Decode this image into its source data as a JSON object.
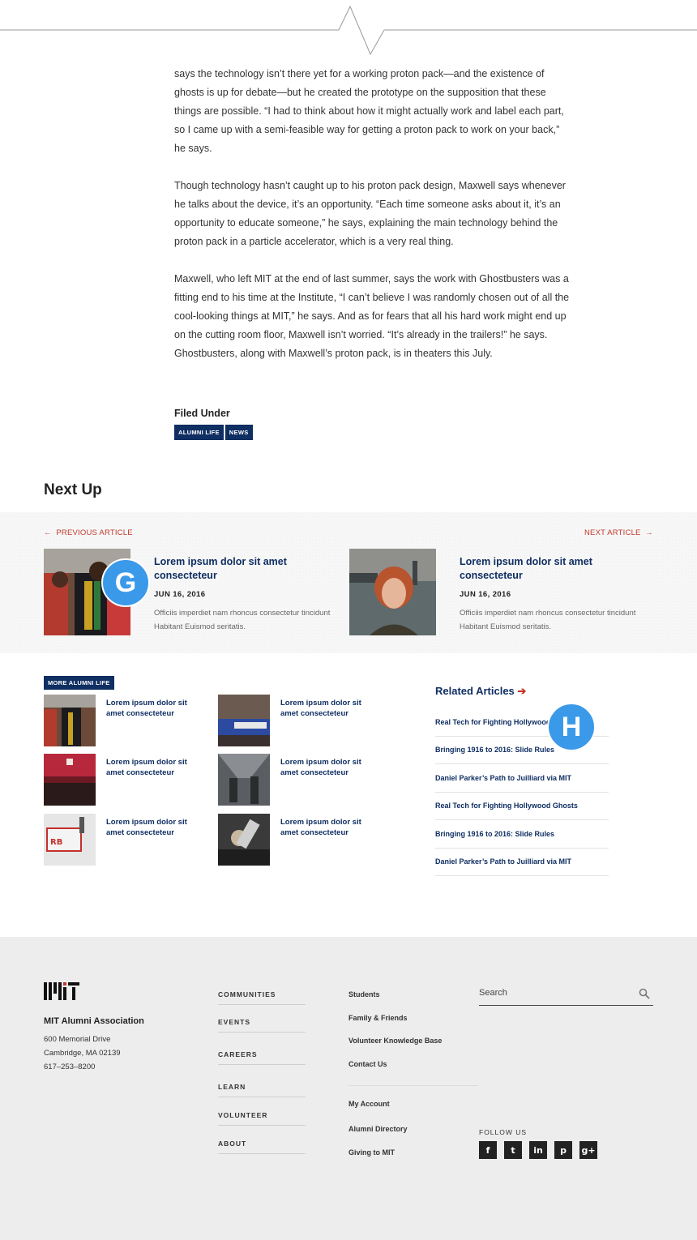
{
  "article": {
    "paragraphs": [
      "says the technology isn’t there yet for a working proton pack—and the existence of ghosts is up for debate—but he created the prototype on the supposition that these things are possible. “I had to think about how it might actually work and label each part, so I came up with a semi-feasible way for getting a proton pack to work on your back,” he says.",
      "Though technology hasn’t caught up to his proton pack design, Maxwell says whenever he talks about the device, it’s an opportunity. “Each time someone asks about it, it’s an opportunity to educate someone,” he says, explaining the main technology behind the proton pack in a particle accelerator, which is a very real thing.",
      "Maxwell, who left MIT at the end of last summer, says the work with Ghostbusters was a fitting end to his time at the Institute, “I can’t believe I was randomly chosen out of all the cool-looking things at MIT,” he says. And as for fears that all his hard work might end up on the cutting room floor, Maxwell isn’t worried. “It’s already in the trailers!” he says. Ghostbusters, along with Maxwell’s proton pack, is in theaters this July."
    ],
    "filed_under_label": "Filed Under",
    "tags": [
      "ALUMNI LIFE",
      "NEWS"
    ]
  },
  "next_up": {
    "title": "Next Up",
    "prev_label": "PREVIOUS ARTICLE",
    "next_label": "NEXT ARTICLE",
    "cards": [
      {
        "title": "Lorem ipsum dolor sit amet consecteteur",
        "date": "JUN 16, 2016",
        "desc": "Officiis imperdiet nam rhoncus consectetur tincidunt Habitant Euismod seritatis."
      },
      {
        "title": "Lorem ipsum dolor sit amet consecteteur",
        "date": "JUN 16, 2016",
        "desc": "Officiis imperdiet nam rhoncus consectetur tincidunt Habitant Euismod seritatis."
      }
    ]
  },
  "badges": {
    "g": "G",
    "h": "H"
  },
  "more": {
    "label": "MORE ALUMNI LIFE",
    "items": [
      "Lorem ipsum dolor sit amet consecteteur",
      "Lorem ipsum dolor sit amet consecteteur",
      "Lorem ipsum dolor sit amet consecteteur",
      "Lorem ipsum dolor sit amet consecteteur",
      "Lorem ipsum dolor sit amet consecteteur",
      "Lorem ipsum dolor sit amet consecteteur"
    ]
  },
  "related": {
    "title": "Related Articles",
    "arrow": "➔",
    "items": [
      "Real Tech for Fighting Hollywood Ghosts",
      "Bringing 1916 to 2016: Slide Rules",
      "Daniel Parker’s Path to Juilliard via MIT",
      "Real Tech for Fighting Hollywood Ghosts",
      "Bringing 1916 to 2016: Slide Rules",
      "Daniel Parker’s Path to Juilliard via MIT"
    ]
  },
  "footer": {
    "org_name": "MIT Alumni Association",
    "address": [
      "600 Memorial Drive",
      "Cambridge, MA 02139",
      "617–253–8200"
    ],
    "nav": [
      "COMMUNITIES",
      "EVENTS",
      "CAREERS",
      "LEARN",
      "VOLUNTEER",
      "ABOUT"
    ],
    "links_top": [
      "Students",
      "Family & Friends",
      "Volunteer Knowledge Base",
      "Contact Us"
    ],
    "links_bottom": [
      "My Account",
      "Alumni Directory",
      "Giving to MIT"
    ],
    "search_placeholder": "Search",
    "follow_label": "FOLLOW US",
    "social_icons": [
      "facebook-icon",
      "twitter-icon",
      "linkedin-icon",
      "pinterest-icon",
      "google-plus-icon"
    ],
    "social_glyphs": [
      "f",
      "t",
      "in",
      "p",
      "g+"
    ]
  },
  "colors": {
    "navy": "#0f2e62",
    "red": "#c0392b",
    "badge_blue": "#3b99ea",
    "footer_bg": "#ededed"
  }
}
